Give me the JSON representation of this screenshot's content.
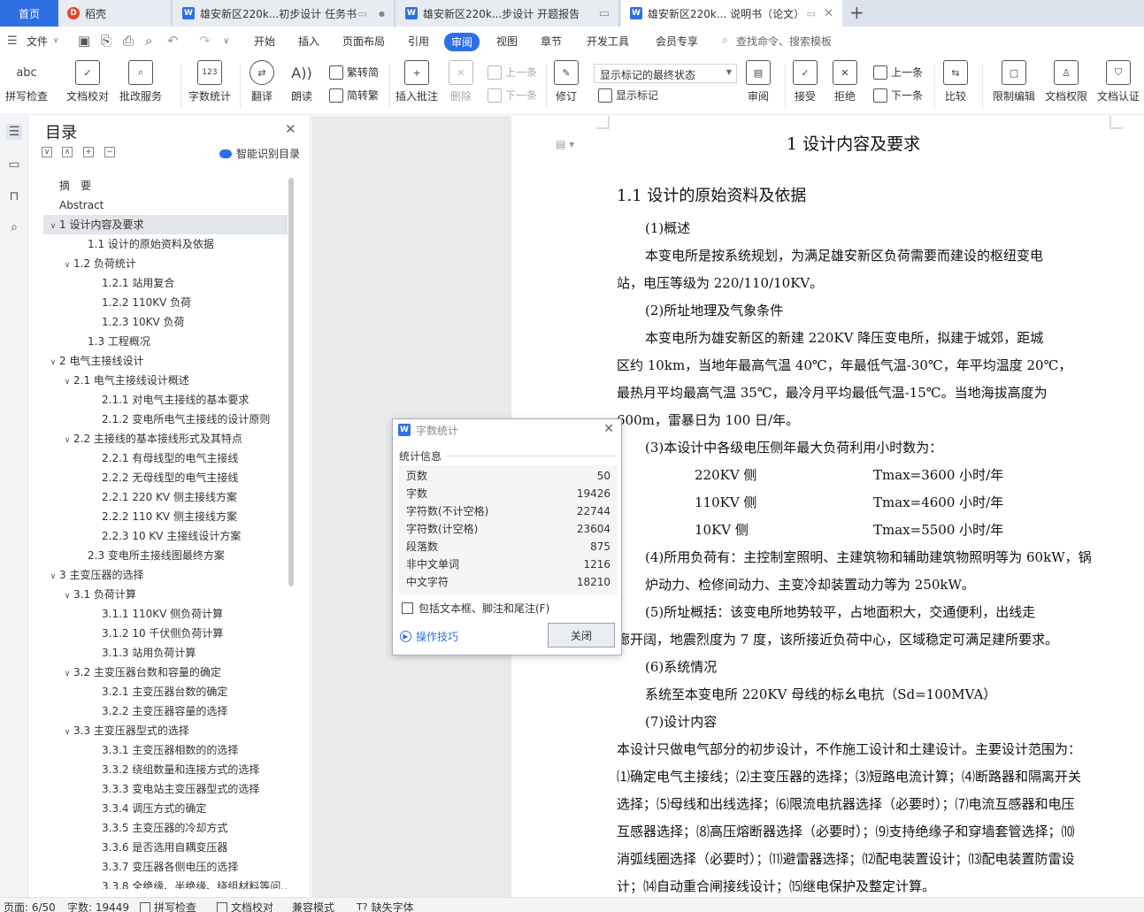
{
  "tabs": {
    "home": "首页",
    "daoke": "稻壳",
    "doc1": "雄安新区220k...初步设计 任务书",
    "doc2": "雄安新区220k...步设计 开题报告",
    "doc3": "雄安新区220k... 说明书（论文）",
    "add": "+"
  },
  "menu": {
    "file": "文件",
    "start": "开始",
    "insert": "插入",
    "layout": "页面布局",
    "reference": "引用",
    "review": "审阅",
    "view": "视图",
    "chapter": "章节",
    "devtools": "开发工具",
    "member": "会员专享",
    "search": "查找命令、搜索模板"
  },
  "ribbon": {
    "spellcheck": "拼写检查",
    "proofread": "文档校对",
    "correction": "批改服务",
    "wordcount": "字数统计",
    "translate": "翻译",
    "readaloud": "朗读",
    "trad": "繁转简",
    "simp": "简转繁",
    "insert_comment": "插入批注",
    "delete": "删除",
    "prev_comment": "上一条",
    "next_comment": "下一条",
    "track": "修订",
    "markup_select": "显示标记的最终状态",
    "show_markup": "显示标记",
    "reviewer": "审阅",
    "accept": "接受",
    "reject": "拒绝",
    "prev_change": "上一条",
    "next_change": "下一条",
    "compare": "比较",
    "restrict": "限制编辑",
    "permission": "文档权限",
    "certify": "文档认证"
  },
  "toc": {
    "title": "目录",
    "smart": "智能识别目录",
    "items": [
      {
        "text": "摘　要",
        "indent": 0,
        "tw": ""
      },
      {
        "text": "Abstract",
        "indent": 0,
        "tw": ""
      },
      {
        "text": "1  设计内容及要求",
        "indent": 0,
        "tw": "∨",
        "active": true
      },
      {
        "text": "1.1  设计的原始资料及依据",
        "indent": 2,
        "tw": ""
      },
      {
        "text": "1.2  负荷统计",
        "indent": 1,
        "tw": "∨"
      },
      {
        "text": "1.2.1  站用复合",
        "indent": 3,
        "tw": ""
      },
      {
        "text": "1.2.2 110KV 负荷",
        "indent": 3,
        "tw": ""
      },
      {
        "text": "1.2.3 10KV 负荷",
        "indent": 3,
        "tw": ""
      },
      {
        "text": "1.3  工程概况",
        "indent": 2,
        "tw": ""
      },
      {
        "text": "2  电气主接线设计",
        "indent": 0,
        "tw": "∨"
      },
      {
        "text": "2.1  电气主接线设计概述",
        "indent": 1,
        "tw": "∨"
      },
      {
        "text": "2.1.1  对电气主接线的基本要求",
        "indent": 3,
        "tw": ""
      },
      {
        "text": "2.1.2  变电所电气主接线的设计原则",
        "indent": 3,
        "tw": ""
      },
      {
        "text": "2.2  主接线的基本接线形式及其特点",
        "indent": 1,
        "tw": "∨"
      },
      {
        "text": "2.2.1  有母线型的电气主接线",
        "indent": 3,
        "tw": ""
      },
      {
        "text": "2.2.2  无母线型的电气主接线",
        "indent": 3,
        "tw": ""
      },
      {
        "text": "2.2.1 220 KV 侧主接线方案",
        "indent": 3,
        "tw": ""
      },
      {
        "text": "2.2.2 110 KV 侧主接线方案",
        "indent": 3,
        "tw": ""
      },
      {
        "text": "2.2.3 10 KV 主接线设计方案",
        "indent": 3,
        "tw": ""
      },
      {
        "text": "2.3 变电所主接线图最终方案",
        "indent": 2,
        "tw": ""
      },
      {
        "text": "3  主变压器的选择",
        "indent": 0,
        "tw": "∨"
      },
      {
        "text": "3.1 负荷计算",
        "indent": 1,
        "tw": "∨"
      },
      {
        "text": "3.1.1 110KV 侧负荷计算",
        "indent": 3,
        "tw": ""
      },
      {
        "text": "3.1.2 10 千伏侧负荷计算",
        "indent": 3,
        "tw": ""
      },
      {
        "text": "3.1.3  站用负荷计算",
        "indent": 3,
        "tw": ""
      },
      {
        "text": "3.2  主变压器台数和容量的确定",
        "indent": 1,
        "tw": "∨"
      },
      {
        "text": "3.2.1  主变压器台数的确定",
        "indent": 3,
        "tw": ""
      },
      {
        "text": "3.2.2  主变压器容量的选择",
        "indent": 3,
        "tw": ""
      },
      {
        "text": "3.3  主变压器型式的选择",
        "indent": 1,
        "tw": "∨"
      },
      {
        "text": "3.3.1  主变压器相数的的选择",
        "indent": 3,
        "tw": ""
      },
      {
        "text": "3.3.2 绕组数量和连接方式的选择",
        "indent": 3,
        "tw": ""
      },
      {
        "text": "3.3.3 变电站主变压器型式的选择",
        "indent": 3,
        "tw": ""
      },
      {
        "text": "3.3.4 调压方式的确定",
        "indent": 3,
        "tw": ""
      },
      {
        "text": "3.3.5 主变压器的冷却方式",
        "indent": 3,
        "tw": ""
      },
      {
        "text": "3.3.6 是否选用自耦变压器",
        "indent": 3,
        "tw": ""
      },
      {
        "text": "3.3.7 变压器各侧电压的选择",
        "indent": 3,
        "tw": ""
      },
      {
        "text": "3.3.8 全绝缘、半绝缘、绕组材料等问…",
        "indent": 3,
        "tw": ""
      }
    ]
  },
  "doc": {
    "h1": "1  设计内容及要求",
    "h2": "1.1  设计的原始资料及依据",
    "lines": [
      "(1)概述",
      "本变电所是按系统规划，为满足雄安新区负荷需要而建设的枢纽变电",
      "站，电压等级为 220/110/10KV。",
      "(2)所址地理及气象条件",
      "本变电所为雄安新区的新建 220KV 降压变电所，拟建于城郊，距城",
      "区约 10km，当地年最高气温 40℃，年最低气温-30℃，年平均温度 20℃，",
      "最热月平均最高气温 35℃，最冷月平均最低气温-15℃。当地海拔高度为",
      "600m，雷暴日为 100 日/年。",
      "(3)本设计中各级电压侧年最大负荷利用小时数为：",
      "220KV 侧",
      "Tmax=3600 小时/年",
      "110KV 侧",
      "Tmax=4600 小时/年",
      "10KV 侧",
      "Tmax=5500 小时/年",
      "(4)所用负荷有：主控制室照明、主建筑物和辅助建筑物照明等为 60kW，锅",
      "炉动力、检修间动力、主变冷却装置动力等为 250kW。",
      "(5)所址概括：该变电所地势较平，占地面积大，交通便利，出线走",
      "廊开阔，地震烈度为 7 度，该所接近负荷中心，区域稳定可满足建所要求。",
      "(6)系统情况",
      "系统至本变电所 220KV 母线的标幺电抗（Sd=100MVA）",
      "(7)设计内容",
      "本设计只做电气部分的初步设计，不作施工设计和土建设计。主要设计范围为：",
      "⑴确定电气主接线；⑵主变压器的选择；⑶短路电流计算；⑷断路器和隔离开关",
      "选择；⑸母线和出线选择；⑹限流电抗器选择（必要时）；⑺电流互感器和电压",
      "互感器选择；⑻高压熔断器选择（必要时）；⑼支持绝缘子和穿墙套管选择；⑽",
      "消弧线圈选择（必要时）；⑾避雷器选择；⑿配电装置设计；⒀配电装置防雷设",
      "计；⒁自动重合闸接线设计；⒂继电保护及整定计算。"
    ]
  },
  "dialog": {
    "title": "字数统计",
    "section": "统计信息",
    "stats": [
      {
        "label": "页数",
        "value": "50"
      },
      {
        "label": "字数",
        "value": "19426"
      },
      {
        "label": "字符数(不计空格)",
        "value": "22744"
      },
      {
        "label": "字符数(计空格)",
        "value": "23604"
      },
      {
        "label": "段落数",
        "value": "875"
      },
      {
        "label": "非中文单词",
        "value": "1216"
      },
      {
        "label": "中文字符",
        "value": "18210"
      }
    ],
    "checkbox": "包括文本框、脚注和尾注(F)",
    "tips": "操作技巧",
    "close": "关闭"
  },
  "status": {
    "page": "页面: 6/50",
    "words": "字数: 19449",
    "spell": "拼写检查",
    "proof": "文档校对",
    "compat": "兼容模式",
    "missing_font": "缺失字体"
  },
  "colors": {
    "accent": "#2f6fe4",
    "canvas": "#e9eaec"
  }
}
